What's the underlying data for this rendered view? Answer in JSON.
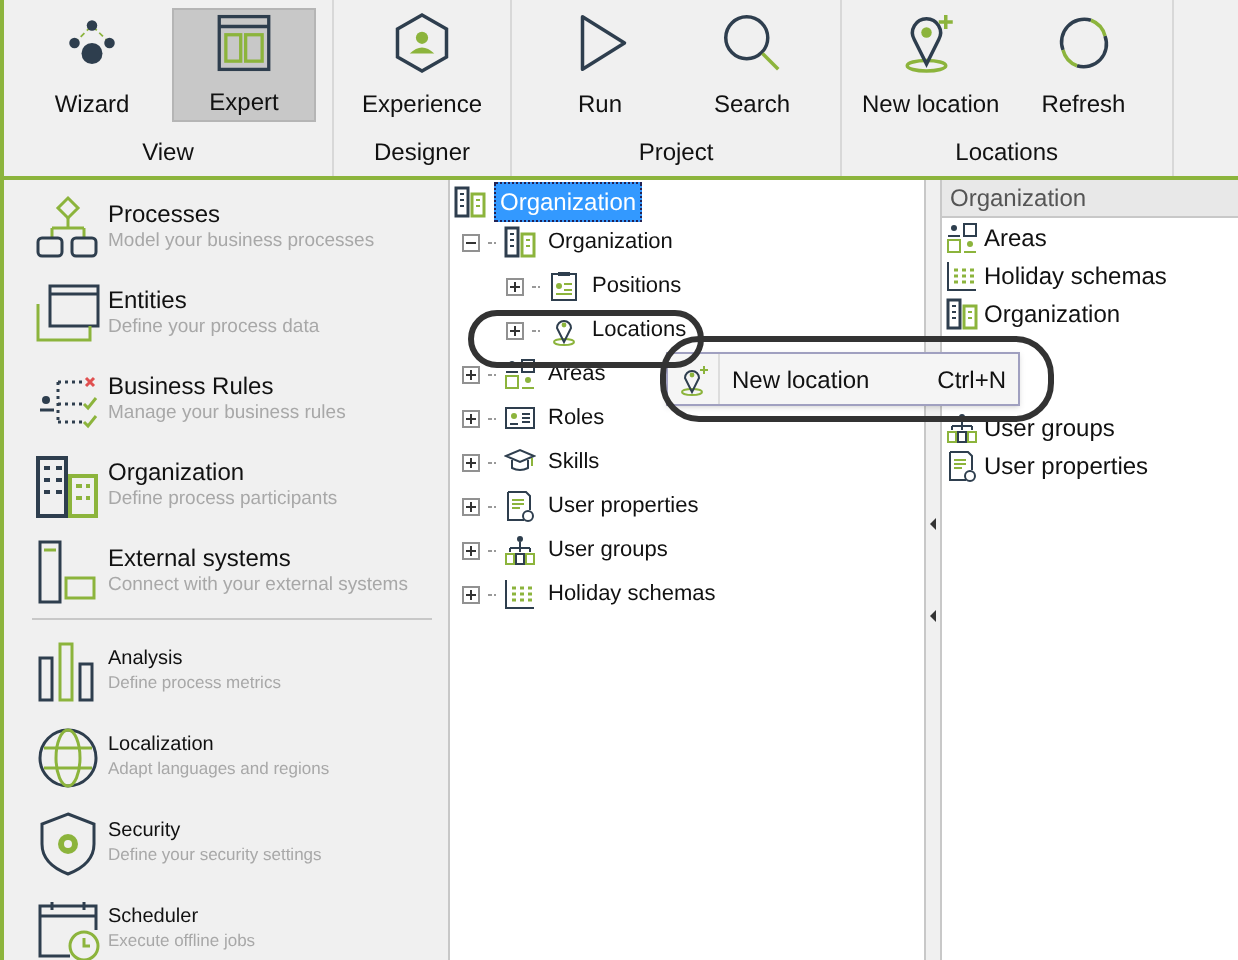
{
  "toolbar": {
    "groups": [
      {
        "label": "View",
        "buttons": [
          {
            "label": "Wizard",
            "kind": "wizard",
            "selected": false
          },
          {
            "label": "Expert",
            "kind": "expert",
            "selected": true
          }
        ]
      },
      {
        "label": "Designer",
        "buttons": [
          {
            "label": "Experience",
            "kind": "experience",
            "selected": false
          }
        ]
      },
      {
        "label": "Project",
        "buttons": [
          {
            "label": "Run",
            "kind": "run",
            "selected": false
          },
          {
            "label": "Search",
            "kind": "search",
            "selected": false
          }
        ]
      },
      {
        "label": "Locations",
        "buttons": [
          {
            "label": "New location",
            "kind": "newlocation",
            "selected": false
          },
          {
            "label": "Refresh",
            "kind": "refresh",
            "selected": false
          }
        ]
      }
    ]
  },
  "sidebar": {
    "sections": [
      {
        "kind": "large",
        "items": [
          {
            "title": "Processes",
            "subtitle": "Model your business processes",
            "kind": "processes"
          },
          {
            "title": "Entities",
            "subtitle": "Define your process data",
            "kind": "entities"
          },
          {
            "title": "Business Rules",
            "subtitle": "Manage your business rules",
            "kind": "rules"
          },
          {
            "title": "Organization",
            "subtitle": "Define process participants",
            "kind": "organization"
          },
          {
            "title": "External systems",
            "subtitle": "Connect with your external systems",
            "kind": "external"
          }
        ]
      },
      {
        "kind": "small",
        "items": [
          {
            "title": "Analysis",
            "subtitle": "Define process metrics",
            "kind": "analysis"
          },
          {
            "title": "Localization",
            "subtitle": "Adapt languages and regions",
            "kind": "globe"
          },
          {
            "title": "Security",
            "subtitle": "Define your security settings",
            "kind": "security"
          },
          {
            "title": "Scheduler",
            "subtitle": "Execute offline jobs",
            "kind": "scheduler"
          }
        ]
      }
    ]
  },
  "tree": {
    "root": {
      "label": "Organization",
      "kind": "organization",
      "selected": true,
      "children": [
        {
          "label": "Organization",
          "kind": "organization",
          "expanded": true,
          "selected": false,
          "children": [
            {
              "label": "Positions",
              "kind": "positions",
              "expanded": false,
              "selected": false
            },
            {
              "label": "Locations",
              "kind": "location",
              "expanded": false,
              "selected": false
            }
          ]
        },
        {
          "label": "Areas",
          "kind": "areas",
          "expanded": false,
          "selected": false
        },
        {
          "label": "Roles",
          "kind": "roles",
          "expanded": false,
          "selected": false
        },
        {
          "label": "Skills",
          "kind": "skills",
          "expanded": false,
          "selected": false
        },
        {
          "label": "User properties",
          "kind": "properties",
          "expanded": false,
          "selected": false
        },
        {
          "label": "User groups",
          "kind": "groups",
          "expanded": false,
          "selected": false
        },
        {
          "label": "Holiday schemas",
          "kind": "holiday",
          "expanded": false,
          "selected": false
        }
      ]
    }
  },
  "context_menu": {
    "items": [
      {
        "label": "New location",
        "shortcut": "Ctrl+N",
        "kind": "newlocation"
      }
    ]
  },
  "right_panel": {
    "header": "Organization",
    "items_top": [
      {
        "label": "Areas",
        "kind": "areas"
      },
      {
        "label": "Holiday schemas",
        "kind": "holiday"
      },
      {
        "label": "Organization",
        "kind": "organization"
      }
    ],
    "items_bottom": [
      {
        "label": "User groups",
        "kind": "groups"
      },
      {
        "label": "User properties",
        "kind": "properties"
      }
    ]
  }
}
